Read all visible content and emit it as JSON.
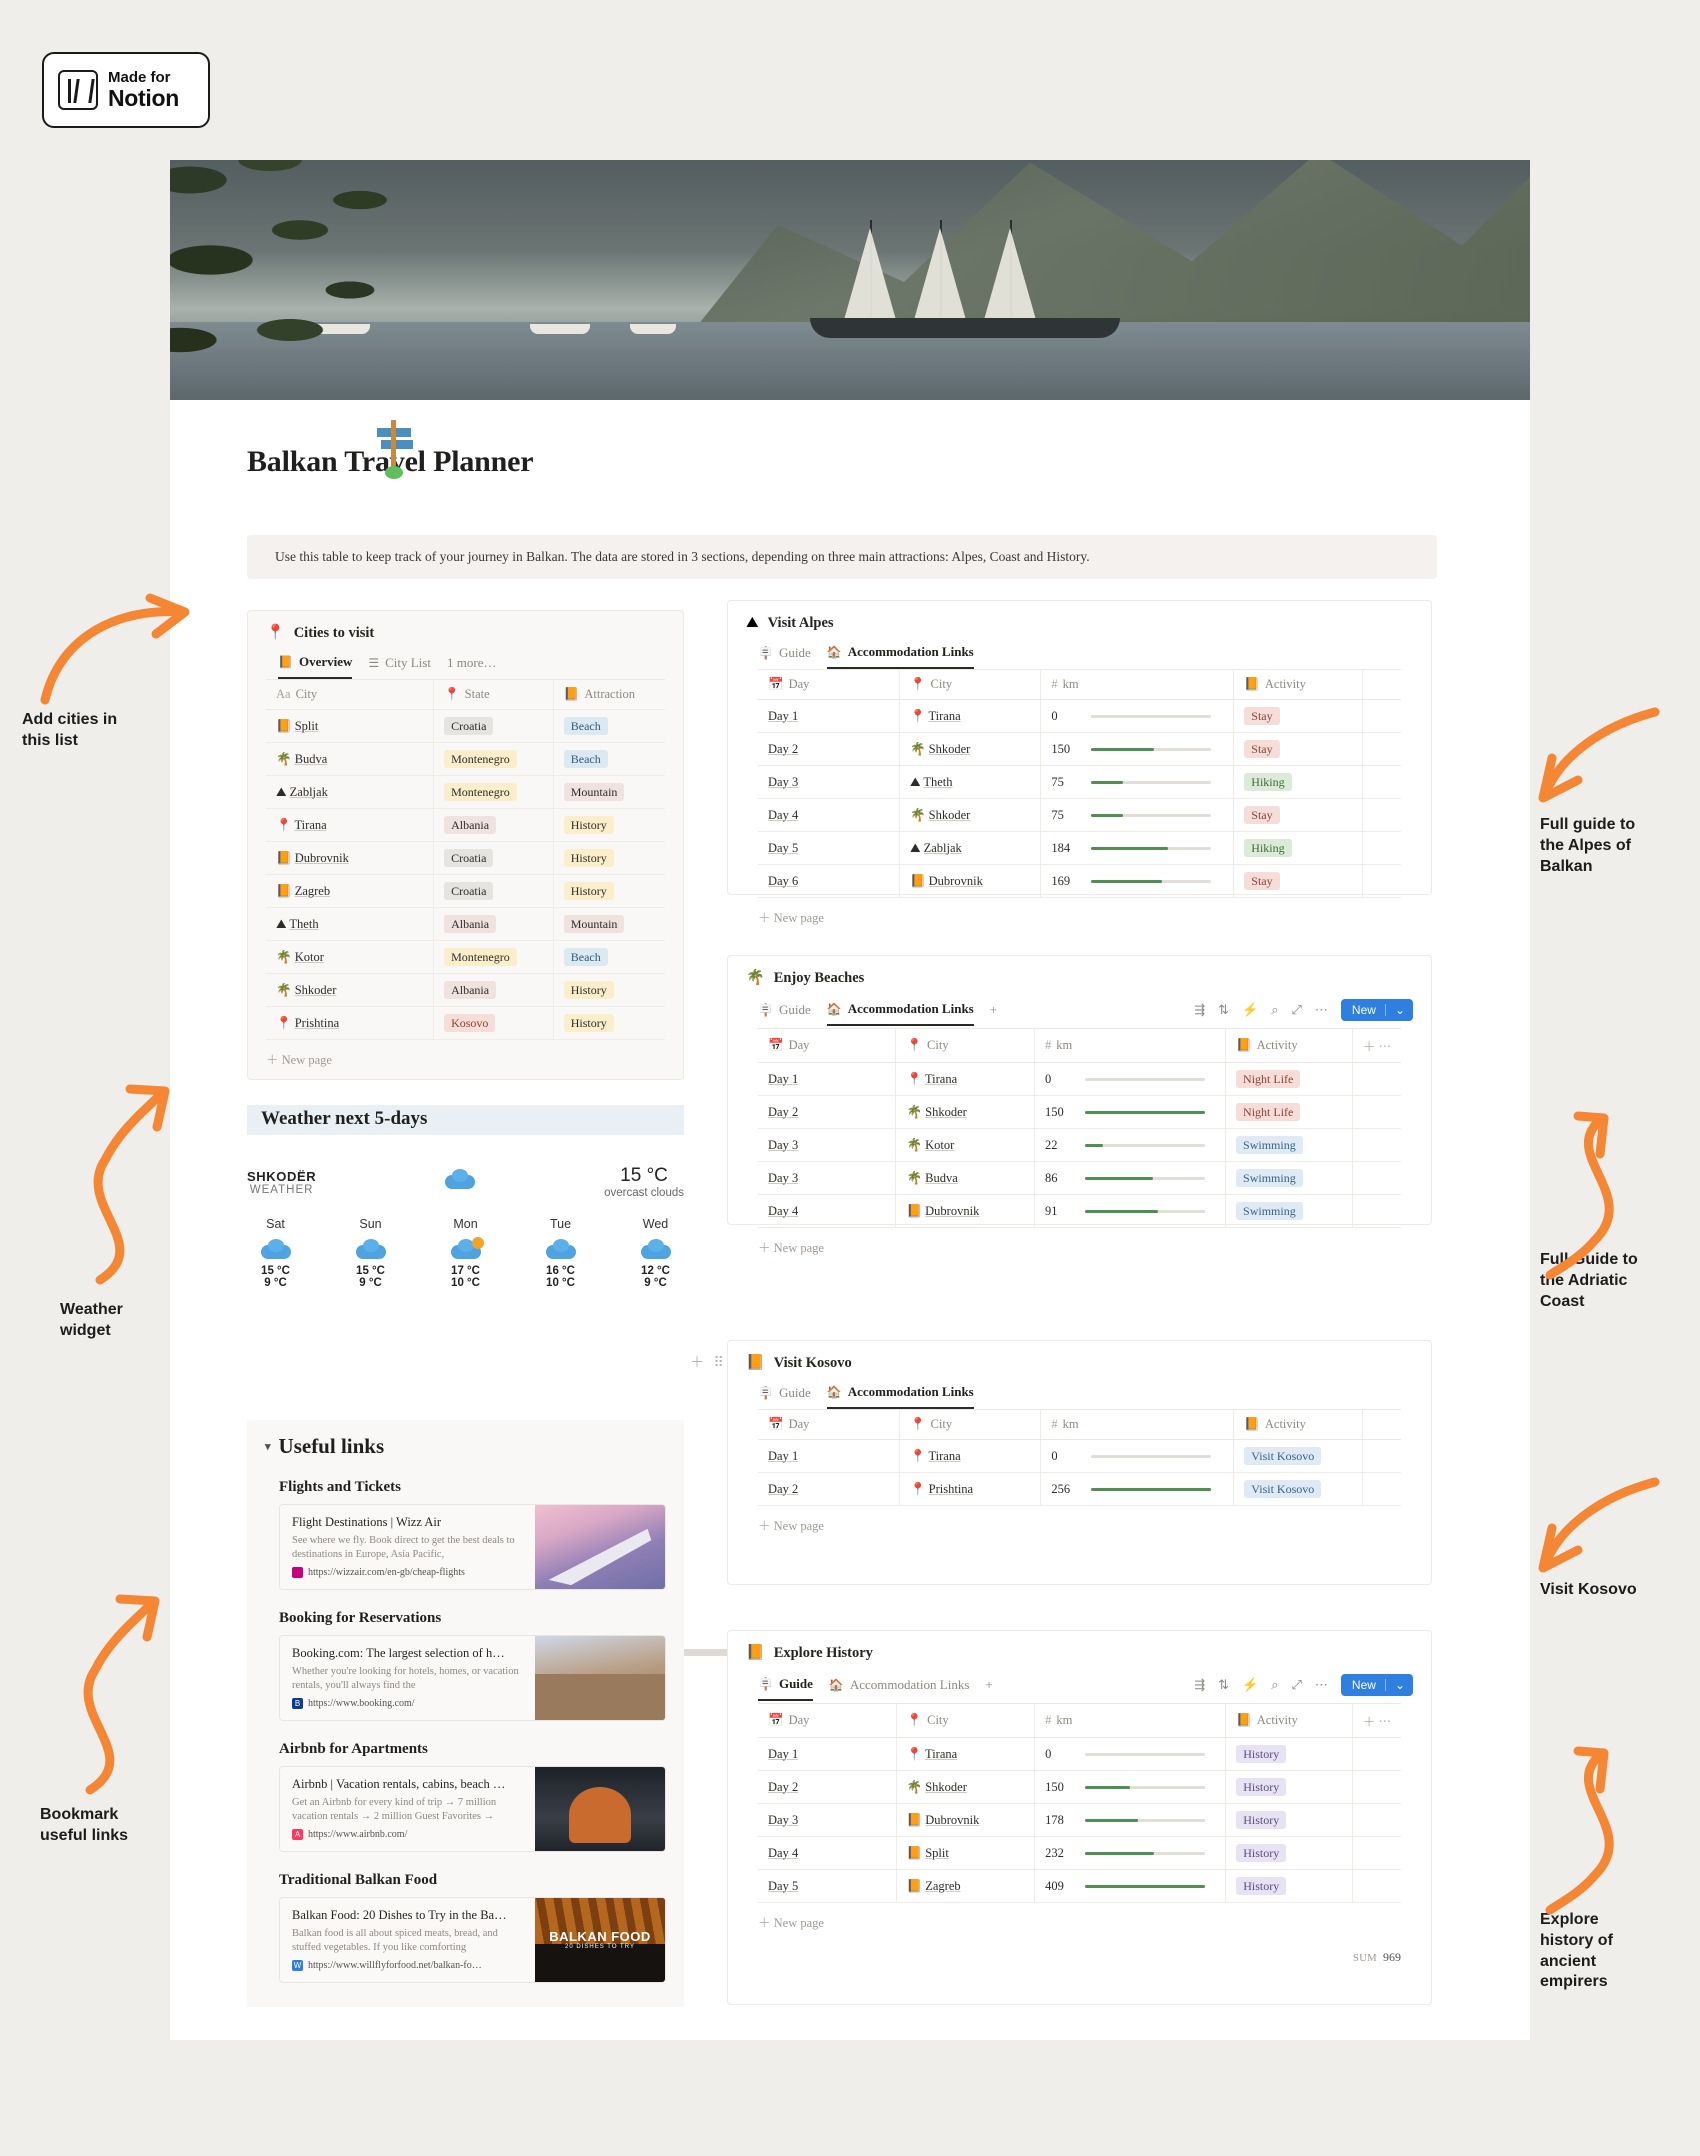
{
  "badge": {
    "line1": "Made for",
    "line2": "Notion"
  },
  "page": {
    "title": "Balkan Travel Planner",
    "callout": "Use this table to keep track of your journey in Balkan. The data are stored in 3 sections, depending on three main attractions: Alpes, Coast and History."
  },
  "cities": {
    "emoji": "📍",
    "name": "Cities to visit",
    "tabs": [
      {
        "icon": "📙",
        "label": "Overview",
        "active": true
      },
      {
        "icon": "☰",
        "label": "City List",
        "active": false
      },
      {
        "icon": "",
        "label": "1 more…",
        "active": false
      }
    ],
    "columns": [
      {
        "icon": "Aa",
        "label": "City"
      },
      {
        "icon": "📍",
        "label": "State"
      },
      {
        "icon": "📙",
        "label": "Attraction"
      }
    ],
    "rows": [
      {
        "icon": "📙",
        "city": "Split",
        "state": "Croatia",
        "state_color": "grey",
        "attraction": "Beach",
        "attraction_color": "blue"
      },
      {
        "icon": "🌴",
        "city": "Budva",
        "state": "Montenegro",
        "state_color": "yellow",
        "attraction": "Beach",
        "attraction_color": "blue"
      },
      {
        "icon": "⛰",
        "city": "Zabljak",
        "state": "Montenegro",
        "state_color": "yellow",
        "attraction": "Mountain",
        "attraction_color": "pinkish"
      },
      {
        "icon": "📍",
        "city": "Tirana",
        "state": "Albania",
        "state_color": "pinkish",
        "attraction": "History",
        "attraction_color": "yellow"
      },
      {
        "icon": "📙",
        "city": "Dubrovnik",
        "state": "Croatia",
        "state_color": "grey",
        "attraction": "History",
        "attraction_color": "yellow"
      },
      {
        "icon": "📙",
        "city": "Zagreb",
        "state": "Croatia",
        "state_color": "grey",
        "attraction": "History",
        "attraction_color": "yellow"
      },
      {
        "icon": "⛰",
        "city": "Theth",
        "state": "Albania",
        "state_color": "pinkish",
        "attraction": "Mountain",
        "attraction_color": "pinkish"
      },
      {
        "icon": "🌴",
        "city": "Kotor",
        "state": "Montenegro",
        "state_color": "yellow",
        "attraction": "Beach",
        "attraction_color": "blue"
      },
      {
        "icon": "🌴",
        "city": "Shkoder",
        "state": "Albania",
        "state_color": "pinkish",
        "attraction": "History",
        "attraction_color": "yellow"
      },
      {
        "icon": "📍",
        "city": "Prishtina",
        "state": "Kosovo",
        "state_color": "red",
        "attraction": "History",
        "attraction_color": "yellow"
      }
    ],
    "new_page": "New page"
  },
  "weather": {
    "heading": "Weather next 5-days",
    "city": "SHKODËR",
    "subtitle": "WEATHER",
    "current_temp": "15 °C",
    "current_desc": "overcast clouds",
    "days": [
      {
        "name": "Sat",
        "high": "15 °C",
        "low": "9 °C",
        "icon": "cloud"
      },
      {
        "name": "Sun",
        "high": "15 °C",
        "low": "9 °C",
        "icon": "cloud"
      },
      {
        "name": "Mon",
        "high": "17 °C",
        "low": "10 °C",
        "icon": "cloud-sun"
      },
      {
        "name": "Tue",
        "high": "16 °C",
        "low": "10 °C",
        "icon": "cloud"
      },
      {
        "name": "Wed",
        "high": "12 °C",
        "low": "9 °C",
        "icon": "cloud"
      }
    ]
  },
  "useful_links": {
    "title": "Useful links",
    "sections": [
      {
        "heading": "Flights and Tickets",
        "bookmark": {
          "title": "Flight Destinations | Wizz Air",
          "desc": "See where we fly. Book direct to get the best deals to destinations in Europe, Asia Pacific,",
          "url": "https://wizzair.com/en-gb/cheap-flights",
          "favicon": "",
          "favicon_color": "#c6007e",
          "image": "plane"
        }
      },
      {
        "heading": "Booking for Reservations",
        "bookmark": {
          "title": "Booking.com: The largest selection of h…",
          "desc": "Whether you're looking for hotels, homes, or vacation rentals, you'll always find the",
          "url": "https://www.booking.com/",
          "favicon": "B",
          "favicon_color": "#0d3b8f",
          "image": "hotel"
        }
      },
      {
        "heading": "Airbnb for Apartments",
        "bookmark": {
          "title": "Airbnb | Vacation rentals, cabins, beach …",
          "desc": "Get an Airbnb for every kind of trip → 7 million vacation rentals → 2 million Guest Favorites →",
          "url": "https://www.airbnb.com/",
          "favicon": "A",
          "favicon_color": "#ff385c",
          "image": "cabin"
        }
      },
      {
        "heading": "Traditional Balkan Food",
        "bookmark": {
          "title": "Balkan Food: 20 Dishes to Try in the Ba…",
          "desc": "Balkan food is all about spiced meats, bread, and stuffed vegetables. If you like comforting",
          "url": "https://www.willflyforfood.net/balkan-fo…",
          "favicon": "W",
          "favicon_color": "#2f7fe0",
          "image": "food",
          "image_label": "BALKAN FOOD",
          "image_sublabel": "20 DISHES TO TRY"
        }
      }
    ]
  },
  "alpes": {
    "emoji": "⛰",
    "name": "Visit Alpes",
    "tabs": [
      {
        "icon": "🪧",
        "label": "Guide",
        "active": false
      },
      {
        "icon": "🏠",
        "label": "Accommodation Links",
        "active": true
      }
    ],
    "columns": [
      {
        "icon": "📅",
        "label": "Day"
      },
      {
        "icon": "📍",
        "label": "City"
      },
      {
        "icon": "#",
        "label": "km"
      },
      {
        "icon": "📙",
        "label": "Activity"
      }
    ],
    "rows": [
      {
        "day": "Day 1",
        "city_icon": "📍",
        "city": "Tirana",
        "km": "0",
        "pct": 0,
        "activity": "Stay",
        "color": "red"
      },
      {
        "day": "Day 2",
        "city_icon": "🌴",
        "city": "Shkoder",
        "km": "150",
        "pct": 52,
        "activity": "Stay",
        "color": "red"
      },
      {
        "day": "Day 3",
        "city_icon": "⛰",
        "city": "Theth",
        "km": "75",
        "pct": 26,
        "activity": "Hiking",
        "color": "green"
      },
      {
        "day": "Day 4",
        "city_icon": "🌴",
        "city": "Shkoder",
        "km": "75",
        "pct": 26,
        "activity": "Stay",
        "color": "red"
      },
      {
        "day": "Day 5",
        "city_icon": "⛰",
        "city": "Zabljak",
        "km": "184",
        "pct": 64,
        "activity": "Hiking",
        "color": "green"
      },
      {
        "day": "Day 6",
        "city_icon": "📙",
        "city": "Dubrovnik",
        "km": "169",
        "pct": 59,
        "activity": "Stay",
        "color": "red"
      }
    ],
    "new_page": "New page"
  },
  "beaches": {
    "emoji": "🌴",
    "name": "Enjoy Beaches",
    "tabs": [
      {
        "icon": "🪧",
        "label": "Guide",
        "active": false
      },
      {
        "icon": "🏠",
        "label": "Accommodation Links",
        "active": true
      }
    ],
    "add_tab": "+",
    "toolbar_icons": [
      "filter-icon",
      "sort-icon",
      "automation-icon",
      "search-icon",
      "expand-icon",
      "more-icon"
    ],
    "new_button": "New",
    "columns": [
      {
        "icon": "📅",
        "label": "Day"
      },
      {
        "icon": "📍",
        "label": "City"
      },
      {
        "icon": "#",
        "label": "km"
      },
      {
        "icon": "📙",
        "label": "Activity"
      }
    ],
    "rows": [
      {
        "day": "Day 1",
        "city_icon": "📍",
        "city": "Tirana",
        "km": "0",
        "pct": 0,
        "activity": "Night Life",
        "color": "red"
      },
      {
        "day": "Day 2",
        "city_icon": "🌴",
        "city": "Shkoder",
        "km": "150",
        "pct": 100,
        "activity": "Night Life",
        "color": "red"
      },
      {
        "day": "Day 3",
        "city_icon": "🌴",
        "city": "Kotor",
        "km": "22",
        "pct": 15,
        "activity": "Swimming",
        "color": "lblue"
      },
      {
        "day": "Day 3",
        "city_icon": "🌴",
        "city": "Budva",
        "km": "86",
        "pct": 57,
        "activity": "Swimming",
        "color": "lblue"
      },
      {
        "day": "Day 4",
        "city_icon": "📙",
        "city": "Dubrovnik",
        "km": "91",
        "pct": 61,
        "activity": "Swimming",
        "color": "lblue"
      }
    ],
    "new_page": "New page"
  },
  "kosovo": {
    "emoji": "📙",
    "name": "Visit Kosovo",
    "tabs": [
      {
        "icon": "🪧",
        "label": "Guide",
        "active": false
      },
      {
        "icon": "🏠",
        "label": "Accommodation Links",
        "active": true
      }
    ],
    "columns": [
      {
        "icon": "📅",
        "label": "Day"
      },
      {
        "icon": "📍",
        "label": "City"
      },
      {
        "icon": "#",
        "label": "km"
      },
      {
        "icon": "📙",
        "label": "Activity"
      }
    ],
    "rows": [
      {
        "day": "Day 1",
        "city_icon": "📍",
        "city": "Tirana",
        "km": "0",
        "pct": 0,
        "activity": "Visit Kosovo",
        "color": "lblue"
      },
      {
        "day": "Day 2",
        "city_icon": "📍",
        "city": "Prishtina",
        "km": "256",
        "pct": 100,
        "activity": "Visit Kosovo",
        "color": "lblue"
      }
    ],
    "new_page": "New page"
  },
  "history": {
    "emoji": "📙",
    "name": "Explore History",
    "tabs": [
      {
        "icon": "🪧",
        "label": "Guide",
        "active": true
      },
      {
        "icon": "🏠",
        "label": "Accommodation Links",
        "active": false
      }
    ],
    "add_tab": "+",
    "new_button": "New",
    "columns": [
      {
        "icon": "📅",
        "label": "Day"
      },
      {
        "icon": "📍",
        "label": "City"
      },
      {
        "icon": "#",
        "label": "km"
      },
      {
        "icon": "📙",
        "label": "Activity"
      }
    ],
    "rows": [
      {
        "day": "Day 1",
        "city_icon": "📍",
        "city": "Tirana",
        "km": "0",
        "pct": 0,
        "activity": "History",
        "color": "purple"
      },
      {
        "day": "Day 2",
        "city_icon": "🌴",
        "city": "Shkoder",
        "km": "150",
        "pct": 37,
        "activity": "History",
        "color": "purple"
      },
      {
        "day": "Day 3",
        "city_icon": "📙",
        "city": "Dubrovnik",
        "km": "178",
        "pct": 44,
        "activity": "History",
        "color": "purple"
      },
      {
        "day": "Day 4",
        "city_icon": "📙",
        "city": "Split",
        "km": "232",
        "pct": 57,
        "activity": "History",
        "color": "purple"
      },
      {
        "day": "Day 5",
        "city_icon": "📙",
        "city": "Zagreb",
        "km": "409",
        "pct": 100,
        "activity": "History",
        "color": "purple"
      }
    ],
    "new_page": "New page",
    "sum_label": "SUM",
    "sum_value": "969"
  },
  "annotations": {
    "left": [
      {
        "text": "Add cities in\nthis list"
      },
      {
        "text": "Weather\nwidget"
      },
      {
        "text": "Bookmark\nuseful links"
      }
    ],
    "right": [
      {
        "text": "Full guide to\nthe Alpes of\nBalkan"
      },
      {
        "text": "Full Guide to\nthe Adriatic\nCoast"
      },
      {
        "text": "Visit Kosovo"
      },
      {
        "text": "Explore\nhistory of\nancient\nempirers"
      }
    ],
    "accent_color": "#f58634"
  }
}
